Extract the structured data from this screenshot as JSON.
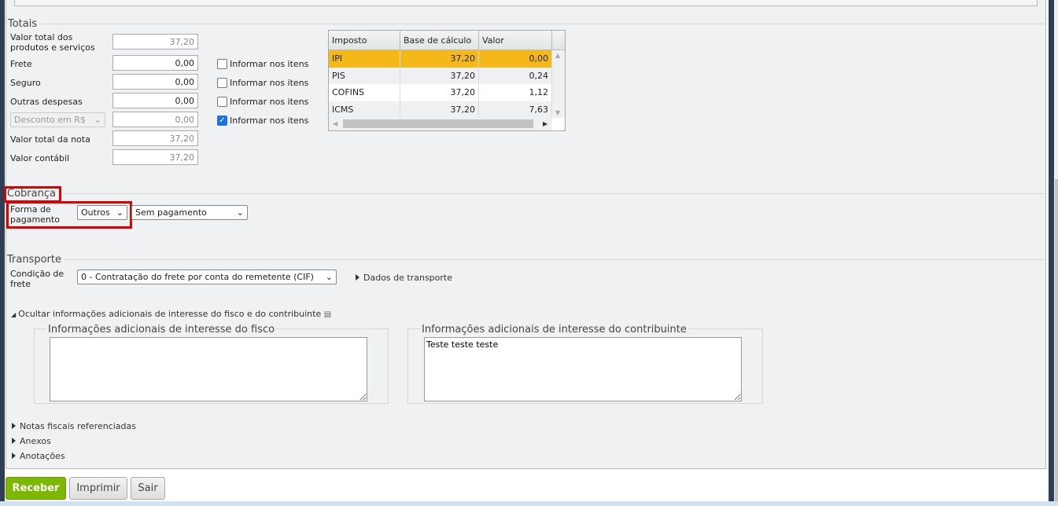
{
  "totais": {
    "title": "Totais",
    "rows": [
      {
        "label": "Valor total dos produtos e serviços",
        "value": "37,20"
      },
      {
        "label": "Frete",
        "value": "0,00",
        "checkbox": "Informar nos itens",
        "checked": false
      },
      {
        "label": "Seguro",
        "value": "0,00",
        "checkbox": "Informar nos itens",
        "checked": false
      },
      {
        "label": "Outras despesas",
        "value": "0,00",
        "checkbox": "Informar nos itens",
        "checked": false
      },
      {
        "label": "Desconto em R$",
        "value": "0,00",
        "checkbox": "Informar nos itens",
        "checked": true
      },
      {
        "label": "Valor total da nota",
        "value": "37,20"
      },
      {
        "label": "Valor contábil",
        "value": "37,20"
      }
    ],
    "tax_table": {
      "headers": [
        "Imposto",
        "Base de cálculo",
        "Valor"
      ],
      "rows": [
        [
          "IPI",
          "37,20",
          "0,00"
        ],
        [
          "PIS",
          "37,20",
          "0,24"
        ],
        [
          "COFINS",
          "37,20",
          "1,12"
        ],
        [
          "ICMS",
          "37,20",
          "7,63"
        ]
      ]
    }
  },
  "cobranca": {
    "title": "Cobrança",
    "label": "Forma de pagamento",
    "forma": "Outros",
    "pagamento": "Sem pagamento"
  },
  "transporte": {
    "title": "Transporte",
    "label": "Condição de frete",
    "condicao": "0 - Contratação do frete por conta do remetente (CIF)",
    "dados_link": "Dados de transporte"
  },
  "info": {
    "toggle": "Ocultar informações adicionais de interesse do fisco e do contribuinte",
    "fisco_title": "Informações adicionais de interesse do fisco",
    "fisco_value": "",
    "contrib_title": "Informações adicionais de interesse do contribuinte",
    "contrib_value": "Teste teste teste"
  },
  "sections": [
    "Notas fiscais referenciadas",
    "Anexos",
    "Anotações"
  ],
  "buttons": {
    "receber": "Receber",
    "imprimir": "Imprimir",
    "sair": "Sair"
  },
  "colors": {
    "accent": "#7cb800",
    "highlight": "#f4b919",
    "annotation": "#e00000"
  }
}
